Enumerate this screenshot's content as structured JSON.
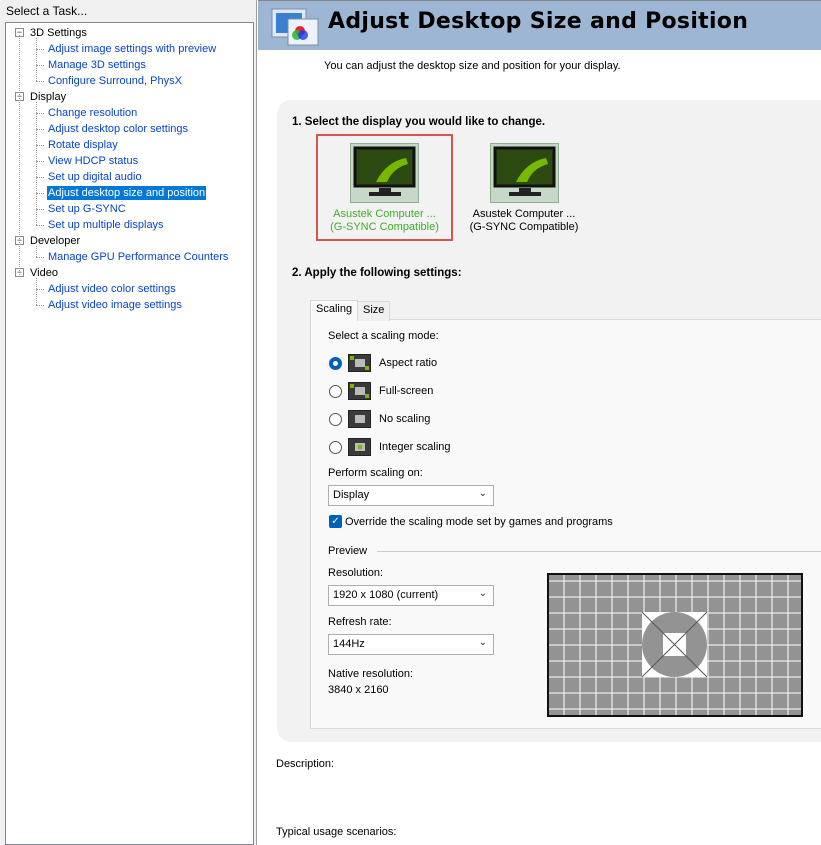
{
  "left": {
    "title": "Select a Task...",
    "tree": [
      {
        "label": "3D Settings",
        "children": [
          "Adjust image settings with preview",
          "Manage 3D settings",
          "Configure Surround, PhysX"
        ]
      },
      {
        "label": "Display",
        "children": [
          "Change resolution",
          "Adjust desktop color settings",
          "Rotate display",
          "View HDCP status",
          "Set up digital audio",
          "Adjust desktop size and position",
          "Set up G-SYNC",
          "Set up multiple displays"
        ]
      },
      {
        "label": "Developer",
        "children": [
          "Manage GPU Performance Counters"
        ]
      },
      {
        "label": "Video",
        "children": [
          "Adjust video color settings",
          "Adjust video image settings"
        ]
      }
    ],
    "selected": "Adjust desktop size and position"
  },
  "page": {
    "title": "Adjust Desktop Size and Position",
    "subtitle": "You can adjust the desktop size and position for your display.",
    "step1": "1. Select the display you would like to change.",
    "displays": [
      {
        "name": "Asustek Computer ...",
        "sub": "(G-SYNC Compatible)"
      },
      {
        "name": "Asustek Computer ...",
        "sub": "(G-SYNC Compatible)"
      }
    ],
    "step2": "2. Apply the following settings:",
    "tabs": [
      "Scaling",
      "Size"
    ],
    "scaling_label": "Select a scaling mode:",
    "modes": [
      "Aspect ratio",
      "Full-screen",
      "No scaling",
      "Integer scaling"
    ],
    "selected_mode": "Aspect ratio",
    "perform_label": "Perform scaling on:",
    "perform_value": "Display",
    "override_label": "Override the scaling mode set by games and programs",
    "override_checked": true,
    "preview_label": "Preview",
    "resolution_label": "Resolution:",
    "resolution_value": "1920 x 1080 (current)",
    "refresh_label": "Refresh rate:",
    "refresh_value": "144Hz",
    "native_label": "Native resolution:",
    "native_value": "3840 x 2160",
    "description_label": "Description:",
    "usage_label": "Typical usage scenarios:"
  },
  "colors": {
    "accent": "#0078d7",
    "header": "#9db6d3",
    "selected_display": "#3fae29",
    "nvidia_green": "#76b900"
  }
}
